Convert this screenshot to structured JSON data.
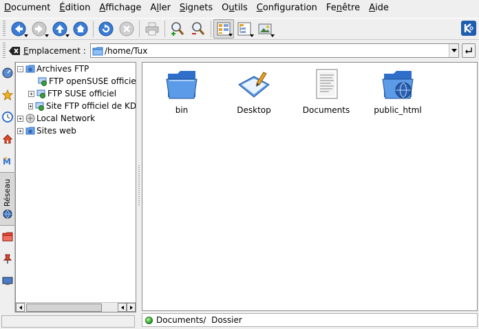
{
  "menu": [
    {
      "pre": "",
      "key": "D",
      "post": "ocument"
    },
    {
      "pre": "",
      "key": "É",
      "post": "dition"
    },
    {
      "pre": "",
      "key": "A",
      "post": "ffichage"
    },
    {
      "pre": "A",
      "key": "l",
      "post": "ler"
    },
    {
      "pre": "",
      "key": "S",
      "post": "ignets"
    },
    {
      "pre": "O",
      "key": "u",
      "post": "tils"
    },
    {
      "pre": "",
      "key": "C",
      "post": "onfiguration"
    },
    {
      "pre": "Fe",
      "key": "n",
      "post": "être"
    },
    {
      "pre": "",
      "key": "A",
      "post": "ide"
    }
  ],
  "location": {
    "label_key": "E",
    "label_rest": "mplacement :",
    "path": "/home/Tux"
  },
  "sidebar": {
    "active_tab": "Réseau"
  },
  "tree": [
    {
      "label": "Archives FTP",
      "expander": "-",
      "icon": "network-folder-icon"
    },
    {
      "label": "FTP openSUSE officiel",
      "expander": "",
      "icon": "ftp-site-icon"
    },
    {
      "label": "FTP SUSE officiel",
      "expander": "+",
      "icon": "ftp-site-icon"
    },
    {
      "label": "Site FTP officiel de KDE",
      "expander": "+",
      "icon": "ftp-site-icon"
    },
    {
      "label": "Local Network",
      "expander": "+",
      "icon": "local-network-icon"
    },
    {
      "label": "Sites web",
      "expander": "+",
      "icon": "network-folder-icon"
    }
  ],
  "files": [
    {
      "name": "bin",
      "icon": "folder-icon"
    },
    {
      "name": "Desktop",
      "icon": "desktop-folder-icon"
    },
    {
      "name": "Documents",
      "icon": "document-icon"
    },
    {
      "name": "public_html",
      "icon": "web-folder-icon"
    }
  ],
  "status": {
    "text": "Documents/  Dossier",
    "led_color": "#1b9a1b"
  },
  "colors": {
    "accent_blue": "#2f6fc9",
    "kde_blue": "#1d5cae"
  }
}
